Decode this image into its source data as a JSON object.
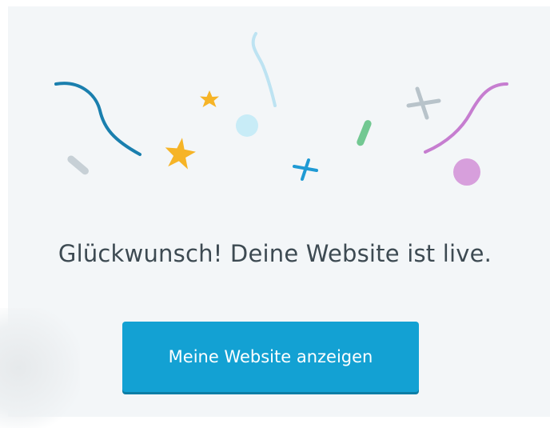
{
  "headline": "Glückwunsch! Deine Website ist live.",
  "cta_label": "Meine Website anzeigen",
  "colors": {
    "background": "#f3f6f8",
    "accent": "#13a1d3",
    "headline": "#3d4a52",
    "star": "#f6b427",
    "ribbon_dark": "#1a7fae",
    "ribbon_light": "#bde3f2",
    "ribbon_purple": "#c67dd0",
    "cross_blue": "#1f9ad4",
    "cross_grey": "#b8c3ca",
    "dot_purple": "#d79fdc",
    "dot_cyan": "#c8ecf7",
    "leaf_green": "#72c892",
    "leaf_grey": "#c7d0d6"
  },
  "icons": [
    "confetti-illustration",
    "star-icon",
    "cross-icon",
    "ribbon-icon",
    "dot-icon"
  ]
}
